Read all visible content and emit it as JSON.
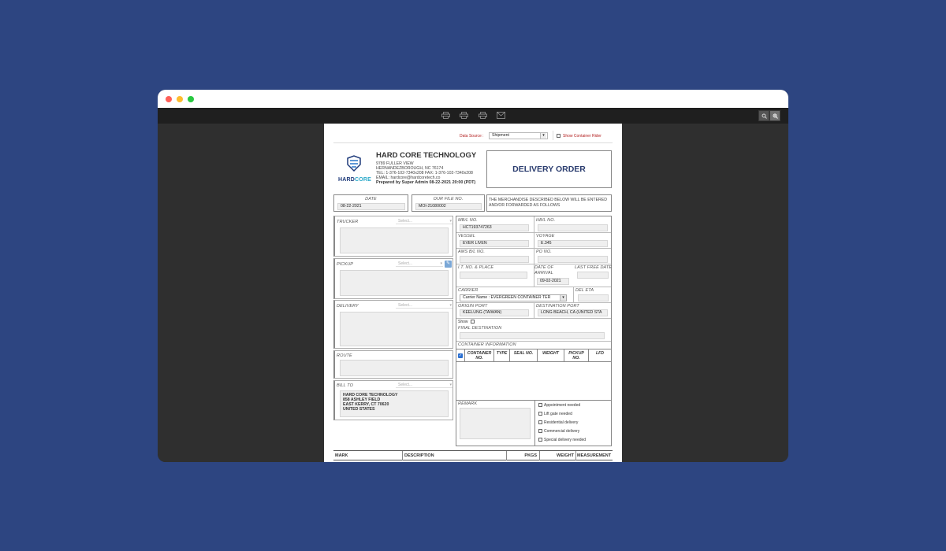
{
  "toolbar": {
    "icons": [
      "print-icon",
      "print-icon",
      "print-icon",
      "mail-icon"
    ],
    "zoom": [
      "zoom-out-icon",
      "zoom-in-icon"
    ]
  },
  "header": {
    "data_source_label": "Data Source :",
    "data_source_value": "Shipment",
    "show_rider_label": "Show Container Rider"
  },
  "company": {
    "logo_text_a": "HARD",
    "logo_text_b": "CORE",
    "name": "HARD CORE TECHNOLOGY",
    "address1": "9789 FULLER VIEW",
    "address2": "HERNANDEZBOROUGH, NC 76174",
    "phone": "TEL: 1-376-102-7340x208 FAX: 1-376-102-7340x208",
    "email": "EMAIL: hardcore@hardcoretech.co",
    "prepared": "Prepared by Super Admin 08-22-2021 20:00 (PDT)"
  },
  "doc_title": "DELIVERY ORDER",
  "date_box": {
    "label": "DATE",
    "value": "08-22-2021"
  },
  "file_box": {
    "label": "OUR FILE NO.",
    "value": "MOI-21080002"
  },
  "merch_note": "THE MERCHANDISE DESCRIBED BELOW WILL BE ENTERED AND/OR FORWARDED AS FOLLOWS",
  "left": {
    "trucker": "TRUCKER",
    "pickup": "PICKUP",
    "delivery": "DELIVERY",
    "route": "ROUTE",
    "bill_to": "BILL TO",
    "select_placeholder": "Select...",
    "bill_to_lines": [
      "HARD CORE TECHNOLOGY",
      "858 ASHLEY FIELD",
      "EAST KERRY, CT 70620",
      "UNITED STATES"
    ]
  },
  "right": {
    "mbl_label": "MB/L NO.",
    "mbl_value": "HCT193747263",
    "hbl_label": "HB/L NO.",
    "hbl_value": "",
    "vessel_label": "VESSEL",
    "vessel_value": "EVER LIVEN",
    "voyage_label": "VOYAGE",
    "voyage_value": "E.345",
    "ams_label": "AMS B/L NO.",
    "po_label": "PO NO.",
    "it_label": "I.T. NO. & PLACE",
    "arrival_label": "DATE OF ARRIVAL",
    "arrival_value": "09-02-2021",
    "last_free_label": "LAST FREE DATE",
    "carrier_label": "CARRIER",
    "carrier_value": "Carrier Name : EVERGREEN CONTAINER TER",
    "del_eta_label": "DEL ETA",
    "origin_label": "ORIGIN PORT",
    "origin_value": "KEELUNG (TAIWAN)",
    "dest_label": "DESTINATION PORT",
    "dest_value": "LONG BEACH, CA (UNITED STA",
    "show_label": "Show",
    "final_dest_label": "FINAL DESTINATION",
    "container_info_label": "CONTAINER INFORMATION",
    "container_cols": [
      "CONTAINER NO.",
      "TYPE",
      "SEAL NO.",
      "WEIGHT",
      "PICKUP NO.",
      "LFD"
    ],
    "remark_label": "REMARK",
    "options": [
      "Appointment needed",
      "Lift gate needed",
      "Residential delivery",
      "Commercial delivery",
      "Special delivery needed"
    ]
  },
  "bottom_table": {
    "cols": [
      "MARK",
      "DESCRIPTION",
      "PKGS",
      "WEIGHT",
      "MEASUREMENT"
    ]
  }
}
